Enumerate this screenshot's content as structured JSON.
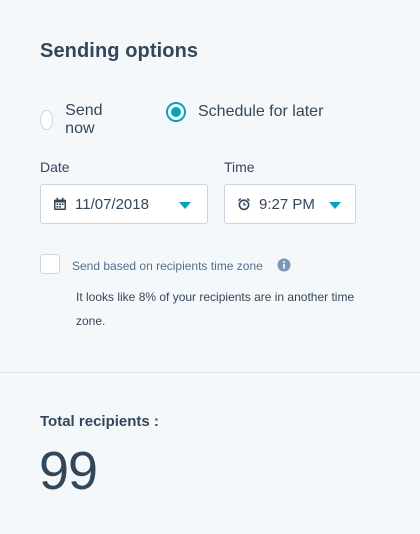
{
  "sending_options": {
    "title": "Sending options",
    "radio_options": [
      {
        "label": "Send now",
        "selected": false
      },
      {
        "label": "Schedule for later",
        "selected": true
      }
    ],
    "date": {
      "label": "Date",
      "value": "11/07/2018",
      "icon": "calendar-icon"
    },
    "time": {
      "label": "Time",
      "value": "9:27 PM",
      "icon": "alarm-clock-icon"
    },
    "timezone_checkbox": {
      "label": "Send based on recipients time zone",
      "checked": false,
      "info_icon": "info-icon"
    },
    "hint": "It looks like 8% of your recipients are in another time zone."
  },
  "recipients": {
    "label": "Total recipients :",
    "count": "99"
  },
  "colors": {
    "accent": "#00a4bd",
    "text": "#33475b",
    "secondary_text": "#516f90",
    "border": "#cbd6e2",
    "background": "#f5f8fa"
  }
}
